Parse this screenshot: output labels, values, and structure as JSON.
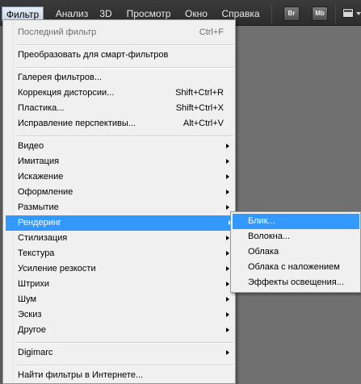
{
  "menubar": {
    "items": [
      "Фильтр",
      "Анализ",
      "3D",
      "Просмотр",
      "Окно",
      "Справка"
    ],
    "active": "Фильтр",
    "app_buttons": [
      "Br",
      "Mb"
    ]
  },
  "filter_menu": {
    "last_filter": {
      "label": "Последний фильтр",
      "shortcut": "Ctrl+F",
      "enabled": false
    },
    "smart": {
      "label": "Преобразовать для смарт-фильтров"
    },
    "gallery": {
      "label": "Галерея фильтров..."
    },
    "lens": {
      "label": "Коррекция дисторсии...",
      "shortcut": "Shift+Ctrl+R"
    },
    "liquify": {
      "label": "Пластика...",
      "shortcut": "Shift+Ctrl+X"
    },
    "perspective": {
      "label": "Исправление перспективы...",
      "shortcut": "Alt+Ctrl+V"
    },
    "categories": [
      "Видео",
      "Имитация",
      "Искажение",
      "Оформление",
      "Размытие",
      "Рендеринг",
      "Стилизация",
      "Текстура",
      "Усиление резкости",
      "Штрихи",
      "Шум",
      "Эскиз",
      "Другое"
    ],
    "highlighted": "Рендеринг",
    "digimarc": {
      "label": "Digimarc"
    },
    "browse": {
      "label": "Найти фильтры в Интернете..."
    }
  },
  "render_submenu": {
    "items": [
      "Блик...",
      "Волокна...",
      "Облака",
      "Облака с наложением",
      "Эффекты освещения..."
    ],
    "highlighted": "Блик..."
  },
  "colors": {
    "highlight": "#3399ff",
    "menu_bg": "#f0f0f0",
    "menubar_bg": "#2c2c2c",
    "canvas_bg": "#707070"
  }
}
